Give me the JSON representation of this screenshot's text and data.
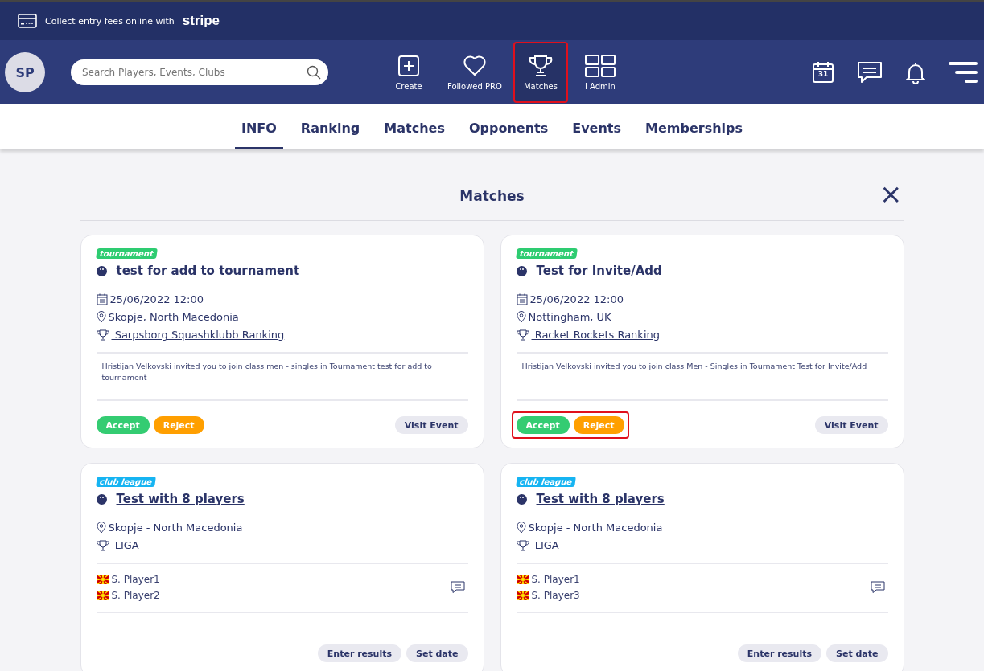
{
  "banner": {
    "text": "Collect entry fees online with",
    "brand": "stripe"
  },
  "header": {
    "avatar": "SP",
    "search": {
      "placeholder": "Search Players, Events, Clubs"
    },
    "nav": [
      {
        "label": "Create",
        "selected": false,
        "highlighted": false
      },
      {
        "label": "Followed PRO",
        "selected": false,
        "highlighted": false
      },
      {
        "label": "Matches",
        "selected": true,
        "highlighted": true
      },
      {
        "label": "I Admin",
        "selected": false,
        "highlighted": false
      }
    ],
    "calendar_day": "31"
  },
  "tabs": [
    {
      "label": "INFO",
      "selected": true
    },
    {
      "label": "Ranking",
      "selected": false
    },
    {
      "label": "Matches",
      "selected": false
    },
    {
      "label": "Opponents",
      "selected": false
    },
    {
      "label": "Events",
      "selected": false
    },
    {
      "label": "Memberships",
      "selected": false
    }
  ],
  "panel": {
    "title": "Matches",
    "close": "×",
    "cards": [
      {
        "kind": "invite",
        "tag": "tournament",
        "color": "#2ecc71",
        "title": "test for add to tournament",
        "title_link": false,
        "date": "25/06/2022 12:00",
        "location": "Skopje, North Macedonia",
        "league": " Sarpsborg Squashklubb Ranking",
        "message": "Hristijan Velkovski invited you to join class men - singles in Tournament test for add to tournament",
        "accept": "Accept",
        "reject": "Reject",
        "highlighted": false,
        "visit": "Visit Event"
      },
      {
        "kind": "invite",
        "tag": "tournament",
        "color": "#2ecc71",
        "title": "Test for Invite/Add",
        "title_link": false,
        "date": "25/06/2022 12:00",
        "location": "Nottingham, UK",
        "league": " Racket Rockets Ranking",
        "message": "Hristijan Velkovski invited you to join class Men - Singles in Tournament Test for Invite/Add",
        "accept": "Accept",
        "reject": "Reject",
        "highlighted": true,
        "visit": "Visit Event"
      },
      {
        "kind": "match",
        "tag": "club league",
        "color": "#16b4f2",
        "title": "Test with 8 players",
        "title_link": true,
        "location": "Skopje - North Macedonia",
        "league": " LIGA",
        "players": [
          "S. Player1",
          "S. Player2"
        ],
        "enter": "Enter results",
        "set_date": "Set date"
      },
      {
        "kind": "match",
        "tag": "club league",
        "color": "#16b4f2",
        "title": "Test with 8 players",
        "title_link": true,
        "location": "Skopje - North Macedonia",
        "league": " LIGA",
        "players": [
          "S. Player1",
          "S. Player3"
        ],
        "enter": "Enter results",
        "set_date": "Set date"
      }
    ]
  }
}
